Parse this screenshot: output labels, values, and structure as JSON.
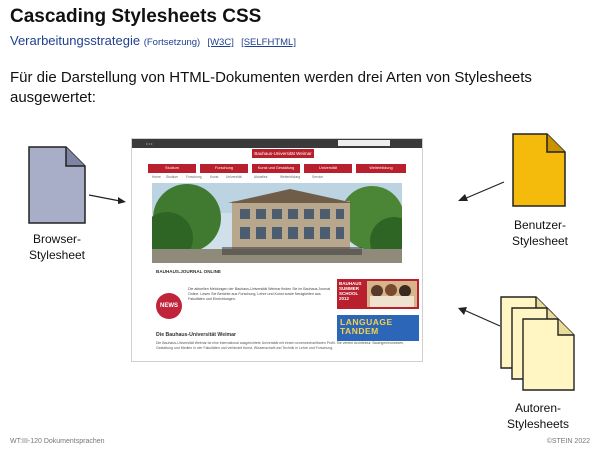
{
  "slide": {
    "title": "Cascading Stylesheets CSS",
    "subtitle_main": "Verarbeitungsstrategie",
    "subtitle_note": "(Fortsetzung)",
    "link_w3c": "[W3C]",
    "link_selfhtml": "[SELFHTML]",
    "intro": "Für die Darstellung von HTML-Dokumenten werden drei Arten von Stylesheets ausgewertet:",
    "footer_left": "WT:III-120   Dokumentsprachen",
    "footer_right": "©STEIN 2022"
  },
  "labels": {
    "browser": [
      "Browser-",
      "Stylesheet"
    ],
    "user": [
      "Benutzer-",
      "Stylesheet"
    ],
    "author": [
      "Autoren-",
      "Stylesheets"
    ]
  },
  "colors": {
    "browser_doc": "#a9aec8",
    "user_doc": "#f5bb0c",
    "author_doc": "#fff6c4",
    "site_red": "#b8202e",
    "subtitle": "#1f3f8f"
  },
  "website": {
    "logo": "Bauhaus-Universität Weimar",
    "nav": [
      "Studium",
      "Forschung",
      "Kunst und Gestaltung",
      "Universität",
      "Weiterbildung"
    ],
    "subnav": [
      "Home",
      "Studium",
      "Forschung",
      "Kunst",
      "Universität",
      "Aktuelles",
      "Weiterbildung",
      "Service"
    ],
    "news_title": "BAUHAUS.JOURNAL ONLINE",
    "news_badge": "NEWS",
    "news_text": "Die aktuellen Meldungen der Bauhaus-Universität Weimar finden Sie im Bauhaus.Journal Online. Lesen Sie Berichte aus Forschung, Lehre und Kunst sowie Neuigkeiten aus Fakultäten und Einrichtungen.",
    "promo_bauhaus": [
      "BAUHAUS",
      "SUMMER",
      "SCHOOL",
      "2012"
    ],
    "promo_language": [
      "LANGUAGE",
      "TANDEM"
    ],
    "intro_title": "Die Bauhaus-Universität Weimar",
    "intro_text": "Die Bauhaus-Universität Weimar ist eine international ausgerichtete Universität mit einem unverwechselbaren Profil. Sie vereint Architektur, Bauingenieurwesen, Gestaltung und Medien in vier Fakultäten und verbindet Kunst, Wissenschaft und Technik in Lehre und Forschung."
  },
  "icons": [
    "document-icon",
    "arrow-icon"
  ]
}
